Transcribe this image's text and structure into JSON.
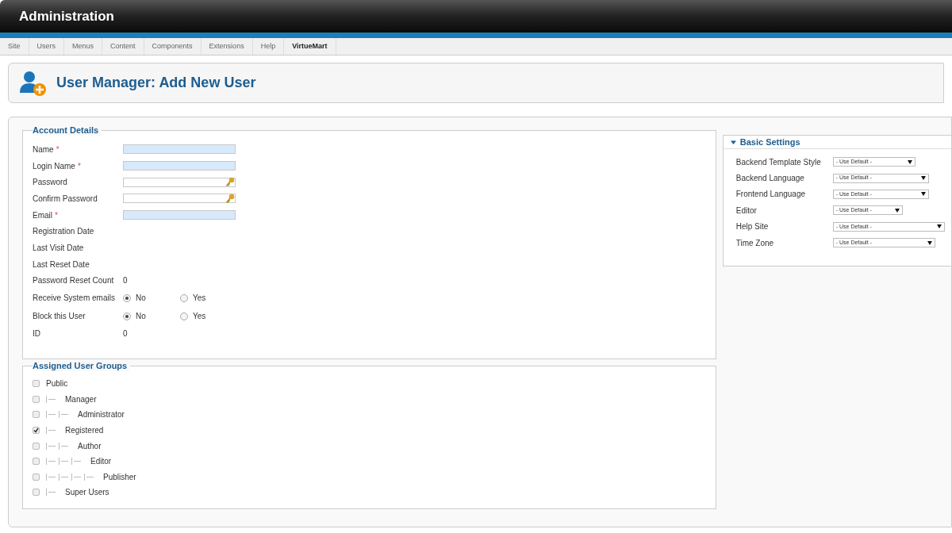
{
  "header": {
    "title": "Administration"
  },
  "menu": [
    {
      "label": "Site",
      "selected": false
    },
    {
      "label": "Users",
      "selected": false
    },
    {
      "label": "Menus",
      "selected": false
    },
    {
      "label": "Content",
      "selected": false
    },
    {
      "label": "Components",
      "selected": false
    },
    {
      "label": "Extensions",
      "selected": false
    },
    {
      "label": "Help",
      "selected": false
    },
    {
      "label": "VirtueMart",
      "selected": true
    }
  ],
  "page_title": "User Manager: Add New User",
  "account_details": {
    "legend": "Account Details",
    "fields": [
      {
        "kind": "input",
        "label": "Name",
        "required": true,
        "mark": "*"
      },
      {
        "kind": "input",
        "label": "Login Name",
        "required": true,
        "mark": "*"
      },
      {
        "kind": "password",
        "label": "Password",
        "required": false
      },
      {
        "kind": "password",
        "label": "Confirm Password",
        "required": false
      },
      {
        "kind": "input",
        "label": "Email",
        "required": true,
        "mark": "*"
      },
      {
        "kind": "static",
        "label": "Registration Date"
      },
      {
        "kind": "static",
        "label": "Last Visit Date"
      },
      {
        "kind": "static",
        "label": "Last Reset Date"
      },
      {
        "kind": "static",
        "label": "Password Reset Count",
        "value": "0"
      },
      {
        "kind": "radio",
        "label": "Receive System emails",
        "options": [
          {
            "label": "No",
            "selected": true
          },
          {
            "label": "Yes",
            "selected": false
          }
        ]
      },
      {
        "kind": "radio",
        "label": "Block this User",
        "options": [
          {
            "label": "No",
            "selected": true
          },
          {
            "label": "Yes",
            "selected": false
          }
        ]
      },
      {
        "kind": "static",
        "label": "ID",
        "value": "0"
      }
    ]
  },
  "user_groups": {
    "legend": "Assigned User Groups",
    "items": [
      {
        "label": "Public",
        "checked": false,
        "children": [
          {
            "label": "Manager",
            "checked": false,
            "children": [
              {
                "label": "Administrator",
                "checked": false
              }
            ]
          },
          {
            "label": "Registered",
            "checked": true,
            "children": [
              {
                "label": "Author",
                "checked": false,
                "children": [
                  {
                    "label": "Editor",
                    "checked": false,
                    "children": [
                      {
                        "label": "Publisher",
                        "checked": false
                      }
                    ]
                  }
                ]
              }
            ]
          },
          {
            "label": "Super Users",
            "checked": false
          }
        ]
      }
    ]
  },
  "basic_settings": {
    "title": "Basic Settings",
    "expanded": true,
    "settings": [
      {
        "label": "Backend Template Style",
        "value": "- Use Default -"
      },
      {
        "label": "Backend Language",
        "value": "- Use Default -"
      },
      {
        "label": "Frontend Language",
        "value": "- Use Default -"
      },
      {
        "label": "Editor",
        "value": "- Use Default -"
      },
      {
        "label": "Help Site",
        "value": "- Use Default -"
      },
      {
        "label": "Time Zone",
        "value": "- Use Default -"
      }
    ]
  }
}
